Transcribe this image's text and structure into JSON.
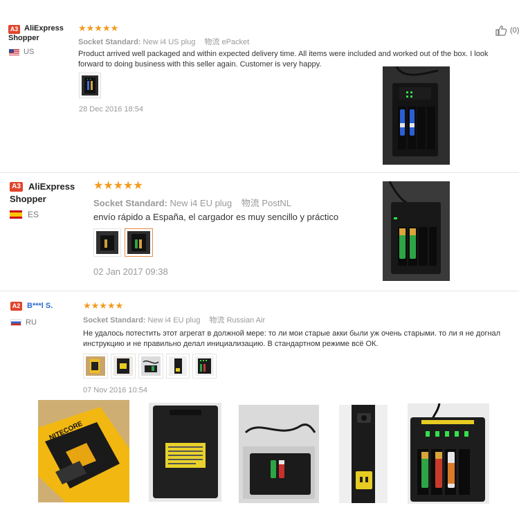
{
  "reviews": [
    {
      "badge": "A3",
      "name": "AliExpress Shopper",
      "country": "US",
      "stars": "★★★★★",
      "meta_label": "Socket Standard:",
      "meta_value": "New i4 US plug",
      "ship_label": "物流",
      "ship_value": "ePacket",
      "text": "Product arrived well packaged and within expected delivery time. All items were included and worked out of the box. I look forward to doing business with this seller again. Customer is very happy.",
      "date": "28 Dec 2016 18:54",
      "likes": "(0)"
    },
    {
      "badge": "A3",
      "name": "AliExpress Shopper",
      "country": "ES",
      "stars": "★★★★★",
      "meta_label": "Socket Standard:",
      "meta_value": "New i4 EU plug",
      "ship_label": "物流",
      "ship_value": "PostNL",
      "text": "envío rápido a España, el cargador es muy sencillo y práctico",
      "date": "02 Jan 2017 09:38"
    },
    {
      "badge": "A2",
      "name": "B***l S.",
      "country": "RU",
      "stars": "★★★★★",
      "meta_label": "Socket Standard:",
      "meta_value": "New i4 EU plug",
      "ship_label": "物流",
      "ship_value": "Russian Air",
      "text": "Не удалось потестить этот агрегат в должной мере: то ли мои старые акки были уж очень старыми. то ли я не догнал инструкцию и не правильно делал инициализацию. В стандартном режиме всё ОК.",
      "date": "07 Nov 2016 10:54"
    }
  ],
  "colors": {
    "accent": "#e0452e",
    "star": "#f49a1c",
    "muted": "#999999",
    "selected_border": "#e88a4a",
    "led": "#35e04a"
  },
  "icons": {
    "like": "thumbs-up-icon"
  }
}
